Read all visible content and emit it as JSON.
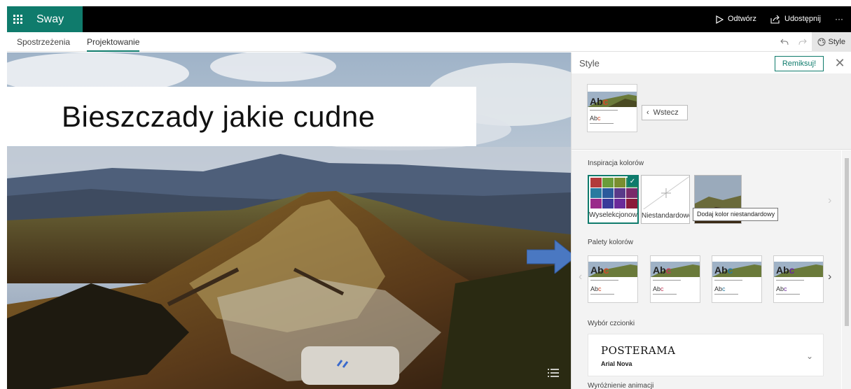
{
  "app": {
    "name": "Sway"
  },
  "topbar": {
    "play_label": "Odtwórz",
    "share_label": "Udostępnij",
    "more_label": "···"
  },
  "tabs": [
    {
      "label": "Spostrzeżenia",
      "active": false
    },
    {
      "label": "Projektowanie",
      "active": true
    }
  ],
  "toolbar": {
    "style_label": "Style"
  },
  "canvas": {
    "title": "Bieszczady jakie cudne"
  },
  "panel": {
    "title": "Style",
    "remix_label": "Remiksuj!",
    "back_label": "Wstecz",
    "tile_abc_big": "Abc",
    "tile_abc_small": "Abc",
    "color_inspiration_label": "Inspiracja kolorów",
    "inspiration_items": [
      {
        "label": "Wyselekcjonowane"
      },
      {
        "label": "Niestandardowe"
      },
      {
        "label": ""
      }
    ],
    "tooltip": "Dodaj kolor niestandardowy",
    "palettes_label": "Palety kolorów",
    "font_section_label": "Wybór czcionki",
    "font_name": "POSTERAMA",
    "font_sub": "Arial Nova",
    "animation_label": "Wyróżnienie animacji"
  },
  "colors": {
    "accent": "#0f7b6c",
    "topbar": "#000000",
    "arrow": "#4a78c2"
  },
  "swatches": [
    "#b23a3a",
    "#6a9c3a",
    "#7a8e2f",
    "#2b8a5a",
    "#2a7aa0",
    "#2a5a9c",
    "#5a3a8a",
    "#7a2a6a",
    "#9a2a8a",
    "#3a3a9a",
    "#6a2a9a",
    "#8a1a3a"
  ]
}
